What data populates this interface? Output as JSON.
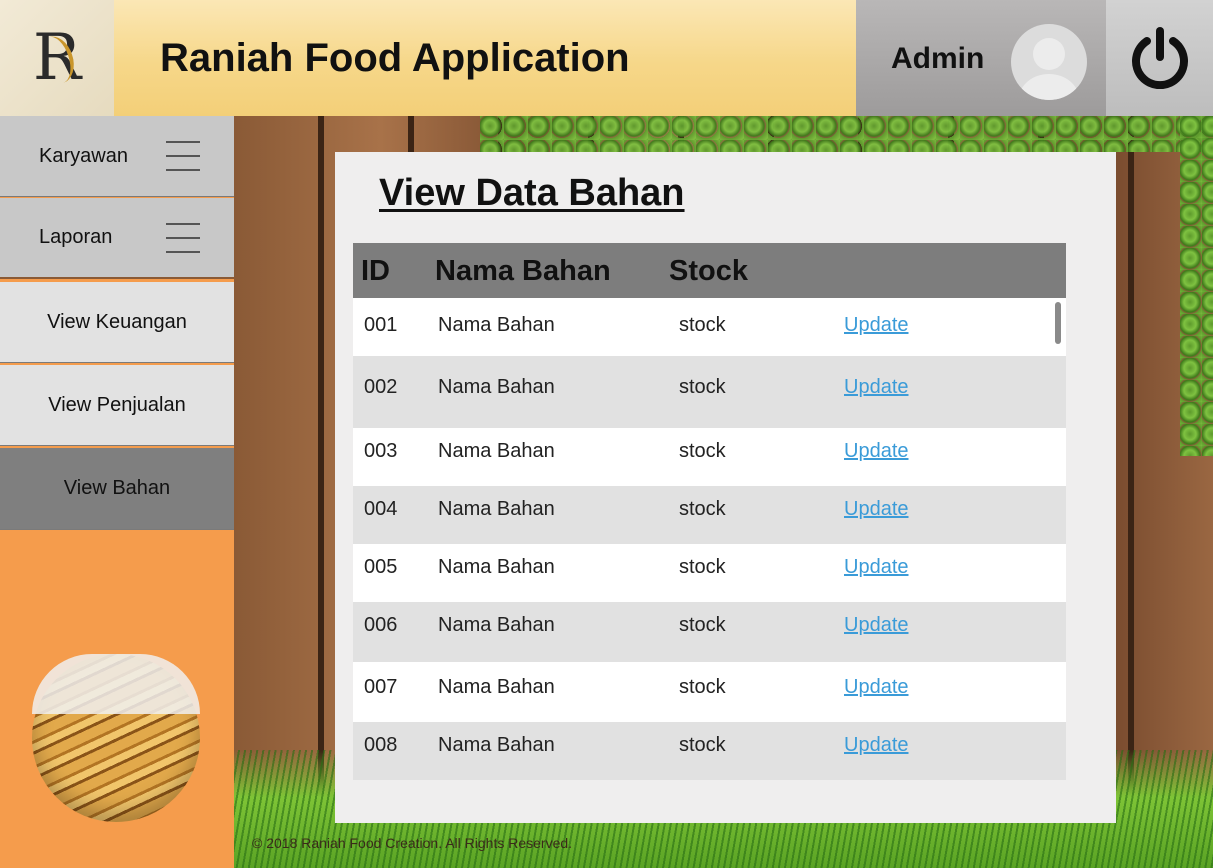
{
  "header": {
    "logo_letter": "R",
    "app_title": "Raniah Food Application",
    "user_name": "Admin"
  },
  "sidebar": {
    "items": [
      {
        "label": "Karyawan",
        "has_menu": true
      },
      {
        "label": "Laporan",
        "has_menu": true
      },
      {
        "label": "View Keuangan",
        "has_menu": false
      },
      {
        "label": "View Penjualan",
        "has_menu": false
      },
      {
        "label": "View Bahan",
        "has_menu": false,
        "active": true
      }
    ]
  },
  "main": {
    "page_title": "View Data Bahan",
    "table": {
      "headers": [
        "ID",
        "Nama Bahan",
        "Stock"
      ],
      "rows": [
        {
          "id": "001",
          "name": "Nama Bahan",
          "stock": "stock",
          "action": "Update"
        },
        {
          "id": "002",
          "name": "Nama Bahan",
          "stock": "stock",
          "action": "Update"
        },
        {
          "id": "003",
          "name": "Nama Bahan",
          "stock": "stock",
          "action": "Update"
        },
        {
          "id": "004",
          "name": "Nama Bahan",
          "stock": "stock",
          "action": "Update"
        },
        {
          "id": "005",
          "name": "Nama Bahan",
          "stock": "stock",
          "action": "Update"
        },
        {
          "id": "006",
          "name": "Nama Bahan",
          "stock": "stock",
          "action": "Update"
        },
        {
          "id": "007",
          "name": "Nama Bahan",
          "stock": "stock",
          "action": "Update"
        },
        {
          "id": "008",
          "name": "Nama Bahan",
          "stock": "stock",
          "action": "Update"
        }
      ]
    }
  },
  "footer": {
    "copyright": "© 2018 Raniah Food Creation. All Rights Reserved."
  },
  "colors": {
    "header_gold": "#f6d789",
    "sidebar_orange": "#f59c4c",
    "active_nav": "#7f7f7f",
    "link_blue": "#3a9bd8",
    "table_header": "#7d7d7d"
  },
  "icons": {
    "power": "power-icon",
    "avatar": "user-avatar-icon",
    "menu": "hamburger-menu-icon"
  }
}
